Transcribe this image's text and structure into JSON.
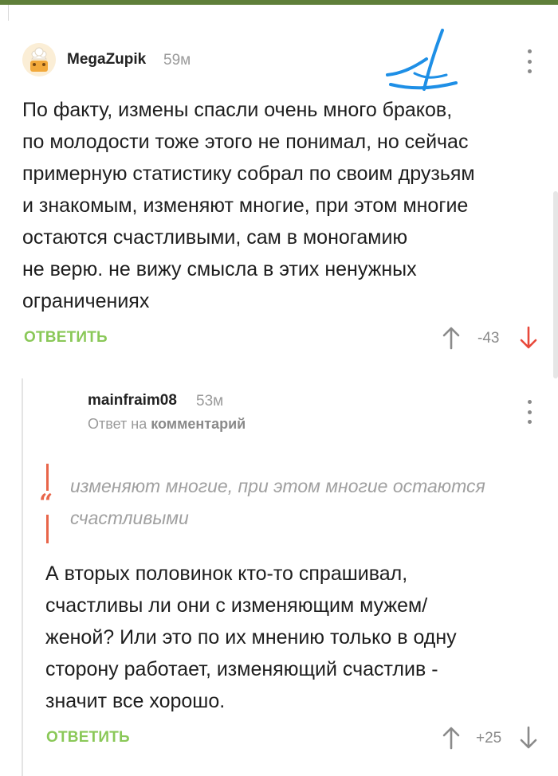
{
  "comments": [
    {
      "username": "MegaZupik",
      "time": "59м",
      "text": [
        "По факту, измены спасли очень много браков,",
        "по молодости тоже этого не понимал, но сейчас",
        "примерную статистику собрал по своим друзьям",
        "и знакомым, изменяют многие, при этом многие",
        "остаются счастливыми, сам в моногамию",
        "не верю. не вижу смысла в этих ненужных",
        "ограничениях"
      ],
      "reply_label": "ОТВЕТИТЬ",
      "score": "-43",
      "downvote_active_color": "#e8483a"
    },
    {
      "username": "mainfraim08",
      "time": "53м",
      "reply_to_prefix": "Ответ на",
      "reply_to_link": "комментарий",
      "quote": [
        "изменяют многие, при этом многие остаются",
        "счастливыми"
      ],
      "text": [
        "А вторых половинок кто-то спрашивал,",
        "счастливы ли они с изменяющим мужем/",
        "женой? Или это по их мнению только в одну",
        "сторону работает, изменяющий счастлив -",
        "значит все хорошо."
      ],
      "reply_label": "ОТВЕТИТЬ",
      "score": "+25"
    }
  ],
  "colors": {
    "accent_green": "#8ac858",
    "downvote_red": "#e8483a",
    "quote_red": "#e8654a",
    "top_bar": "#5f7f3a",
    "scribble_blue": "#1e8fe6"
  },
  "icons": {
    "avatar": "chef-avatar",
    "more": "more-vertical-icon",
    "up": "arrow-up-icon",
    "down": "arrow-down-icon",
    "quote": "quote-icon"
  }
}
